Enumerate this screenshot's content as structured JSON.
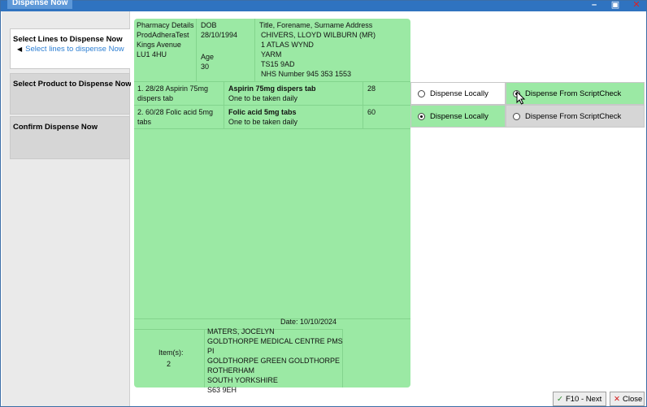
{
  "window": {
    "title": "Dispense Now"
  },
  "sidebar": {
    "steps": [
      {
        "title": "Select Lines to Dispense Now",
        "subtitle": "Select lines to dispense Now"
      },
      {
        "title": "Select Product to Dispense Now"
      },
      {
        "title": "Confirm Dispense Now"
      }
    ]
  },
  "patient": {
    "pharmacy_label": "Pharmacy Details",
    "pharmacy_lines": [
      "ProdAdheraTest",
      "Kings Avenue",
      "LU1 4HU"
    ],
    "dob_label": "DOB",
    "dob": "28/10/1994",
    "age_label": "Age",
    "age": "30",
    "name_label": "Title, Forename, Surname Address",
    "address_lines": [
      "CHIVERS, LLOYD WILBURN (MR)",
      "1 ATLAS WYND",
      "YARM",
      "TS15 9AD"
    ],
    "nhs": "NHS Number 945 353 1553"
  },
  "lines": [
    {
      "desc": [
        "1. 28/28 Aspirin 75mg",
        "dispers tab"
      ],
      "product": "Aspirin 75mg dispers tab",
      "dose": "One to be taken daily",
      "qty": "28",
      "local_label": "Dispense Locally",
      "script_label": "Dispense From ScriptCheck",
      "selected": "script"
    },
    {
      "desc": [
        "2. 60/28 Folic acid 5mg",
        "tabs"
      ],
      "product": "Folic acid 5mg tabs",
      "dose": "One to be taken daily",
      "qty": "60",
      "local_label": "Dispense Locally",
      "script_label": "Dispense From ScriptCheck",
      "selected": "local"
    }
  ],
  "footer": {
    "date": "Date:  10/10/2024",
    "items_label": "Item(s):",
    "items_count": "2",
    "prescriber_lines": [
      "MATERS, JOCELYN",
      "GOLDTHORPE MEDICAL CENTRE PMS PI",
      "GOLDTHORPE GREEN GOLDTHORPE",
      "ROTHERHAM",
      "SOUTH YORKSHIRE",
      "S63 9EH"
    ]
  },
  "buttons": {
    "next": "F10 - Next",
    "close": "Close"
  }
}
